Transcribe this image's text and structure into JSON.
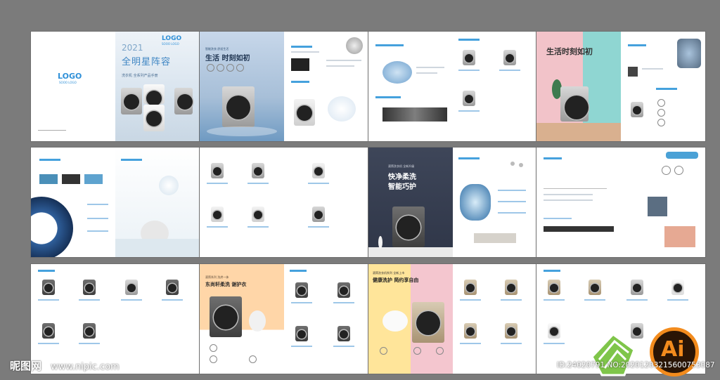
{
  "colors": {
    "background": "#7b7b7b",
    "accent": "#2f90d8",
    "pink": "#f0c1c8",
    "teal": "#8dd4d1",
    "navy": "#3a4458"
  },
  "cover": {
    "logo_top": "LOGO",
    "logo_top_sub": "SOOO LOGO",
    "year": "2021",
    "title": "全明星阵容",
    "subtitle": "洗衣机 全系列产品手册",
    "logo_left": "LOGO",
    "logo_left_sub": "SOOO LOGO"
  },
  "spread2": {
    "headline": "生活 时刻如初",
    "kicker": "智能洗衣 舒适生活"
  },
  "spread4": {
    "headline": "生活时刻如初"
  },
  "spread7": {
    "headline_1": "快净柔洗",
    "headline_2": "智能巧护",
    "kicker": "滚筒洗衣机 全新升级"
  },
  "spread10": {
    "kicker": "滚筒系列 洗烘一体",
    "headline": "东尚轩柔洗 谢护衣"
  },
  "spread11": {
    "kicker": "滚筒洗衣机系列 全新上市",
    "headline": "健康洗护 简约享自由"
  },
  "watermark": {
    "site_logo": "昵图网",
    "site_url": "www.nipic.com",
    "id_text": "ID:24020791 NO:20201203215600753087",
    "badge": "Ai"
  }
}
